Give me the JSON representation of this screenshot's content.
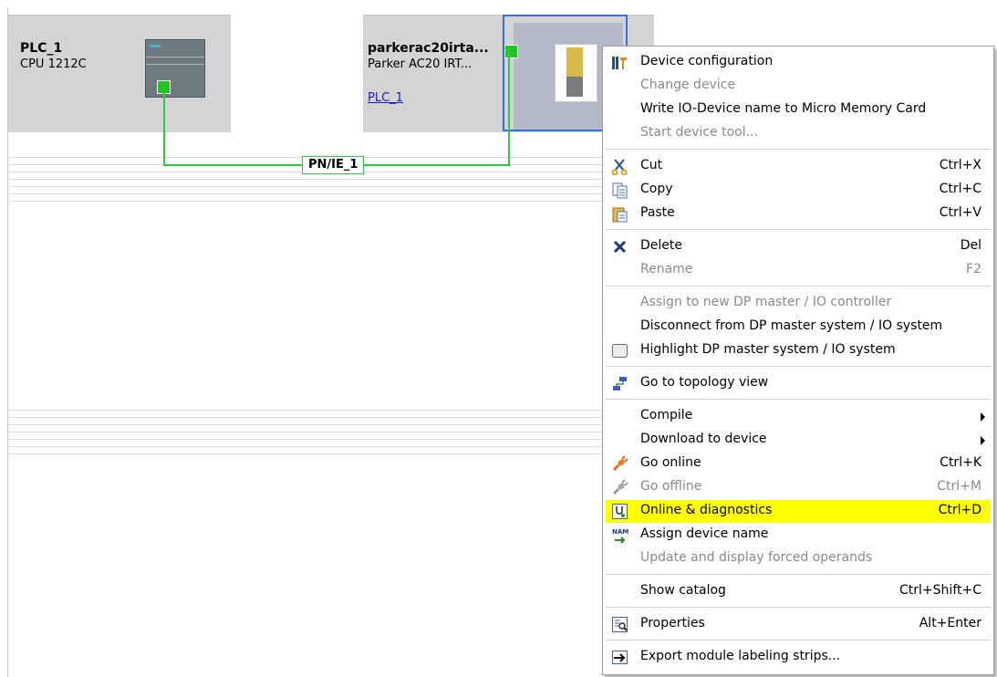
{
  "network_view": {
    "plc": {
      "name": "PLC_1",
      "type": "CPU 1212C"
    },
    "drive": {
      "name": "parkerac20irta...",
      "type": "Parker AC20 IRT...",
      "controller_link": "PLC_1"
    },
    "subnet_label": "PN/IE_1"
  },
  "colors": {
    "highlight": "#ffff00",
    "network": "#2ecc40",
    "selection": "#3a6fd8"
  },
  "context_menu": {
    "device_configuration": {
      "label": "Device configuration",
      "icon": "device-config-icon"
    },
    "change_device": {
      "label": "Change device"
    },
    "write_io_device_name": {
      "label": "Write IO-Device name to Micro Memory Card"
    },
    "start_device_tool": {
      "label": "Start device tool..."
    },
    "cut": {
      "label": "Cut",
      "shortcut": "Ctrl+X",
      "icon": "scissors-icon"
    },
    "copy": {
      "label": "Copy",
      "shortcut": "Ctrl+C",
      "icon": "copy-icon"
    },
    "paste": {
      "label": "Paste",
      "shortcut": "Ctrl+V",
      "icon": "paste-icon"
    },
    "delete": {
      "label": "Delete",
      "shortcut": "Del",
      "icon": "delete-x-icon"
    },
    "rename": {
      "label": "Rename",
      "shortcut": "F2"
    },
    "assign_new_master": {
      "label": "Assign to new DP master / IO controller"
    },
    "disconnect_master": {
      "label": "Disconnect from DP master system / IO system"
    },
    "highlight_master": {
      "label": "Highlight DP master system / IO system",
      "icon": "checkbox-icon"
    },
    "topology_view": {
      "label": "Go to topology view",
      "icon": "topology-icon"
    },
    "compile": {
      "label": "Compile"
    },
    "download": {
      "label": "Download to device"
    },
    "go_online": {
      "label": "Go online",
      "shortcut": "Ctrl+K",
      "icon": "go-online-icon"
    },
    "go_offline": {
      "label": "Go offline",
      "shortcut": "Ctrl+M",
      "icon": "go-offline-icon"
    },
    "online_diagnostics": {
      "label": "Online & diagnostics",
      "shortcut": "Ctrl+D",
      "icon": "diagnostics-icon"
    },
    "assign_device_name": {
      "label": "Assign device name",
      "icon": "name-assign-icon"
    },
    "update_forced": {
      "label": "Update and display forced operands"
    },
    "show_catalog": {
      "label": "Show catalog",
      "shortcut": "Ctrl+Shift+C"
    },
    "properties": {
      "label": "Properties",
      "shortcut": "Alt+Enter",
      "icon": "properties-icon"
    },
    "export_strips": {
      "label": "Export module labeling strips...",
      "icon": "export-arrow-icon"
    }
  }
}
